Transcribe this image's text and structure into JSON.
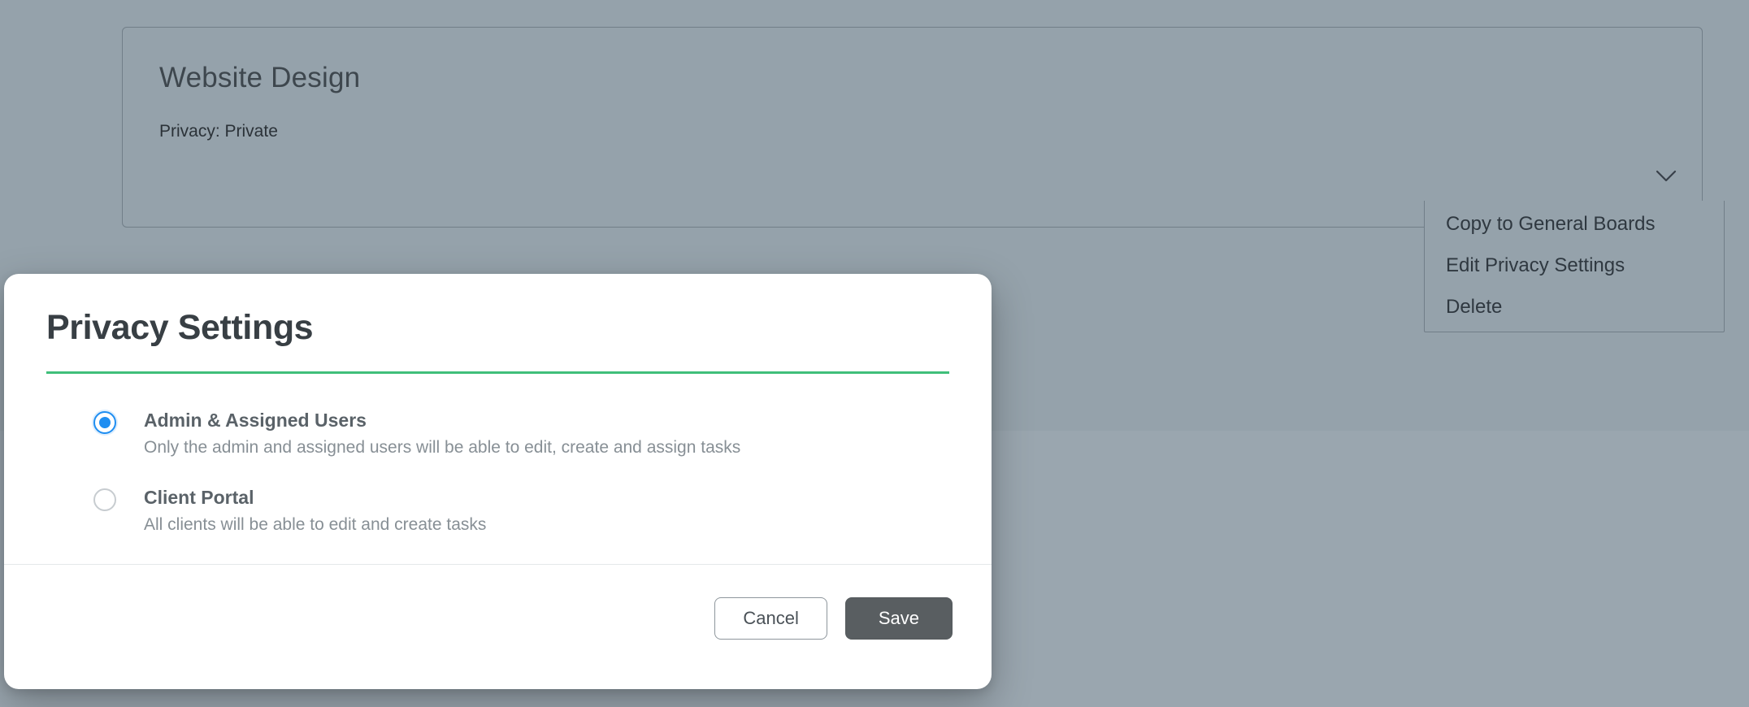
{
  "card": {
    "title": "Website Design",
    "privacy_label": "Privacy: Private"
  },
  "menu": {
    "items": [
      "Copy to General Boards",
      "Edit Privacy Settings",
      "Delete"
    ]
  },
  "modal": {
    "title": "Privacy Settings",
    "options": [
      {
        "title": "Admin & Assigned Users",
        "desc": "Only the admin and assigned users will be able to edit, create and assign tasks",
        "selected": true
      },
      {
        "title": "Client Portal",
        "desc": "All clients will be able to edit and create tasks",
        "selected": false
      }
    ],
    "cancel_label": "Cancel",
    "save_label": "Save"
  }
}
